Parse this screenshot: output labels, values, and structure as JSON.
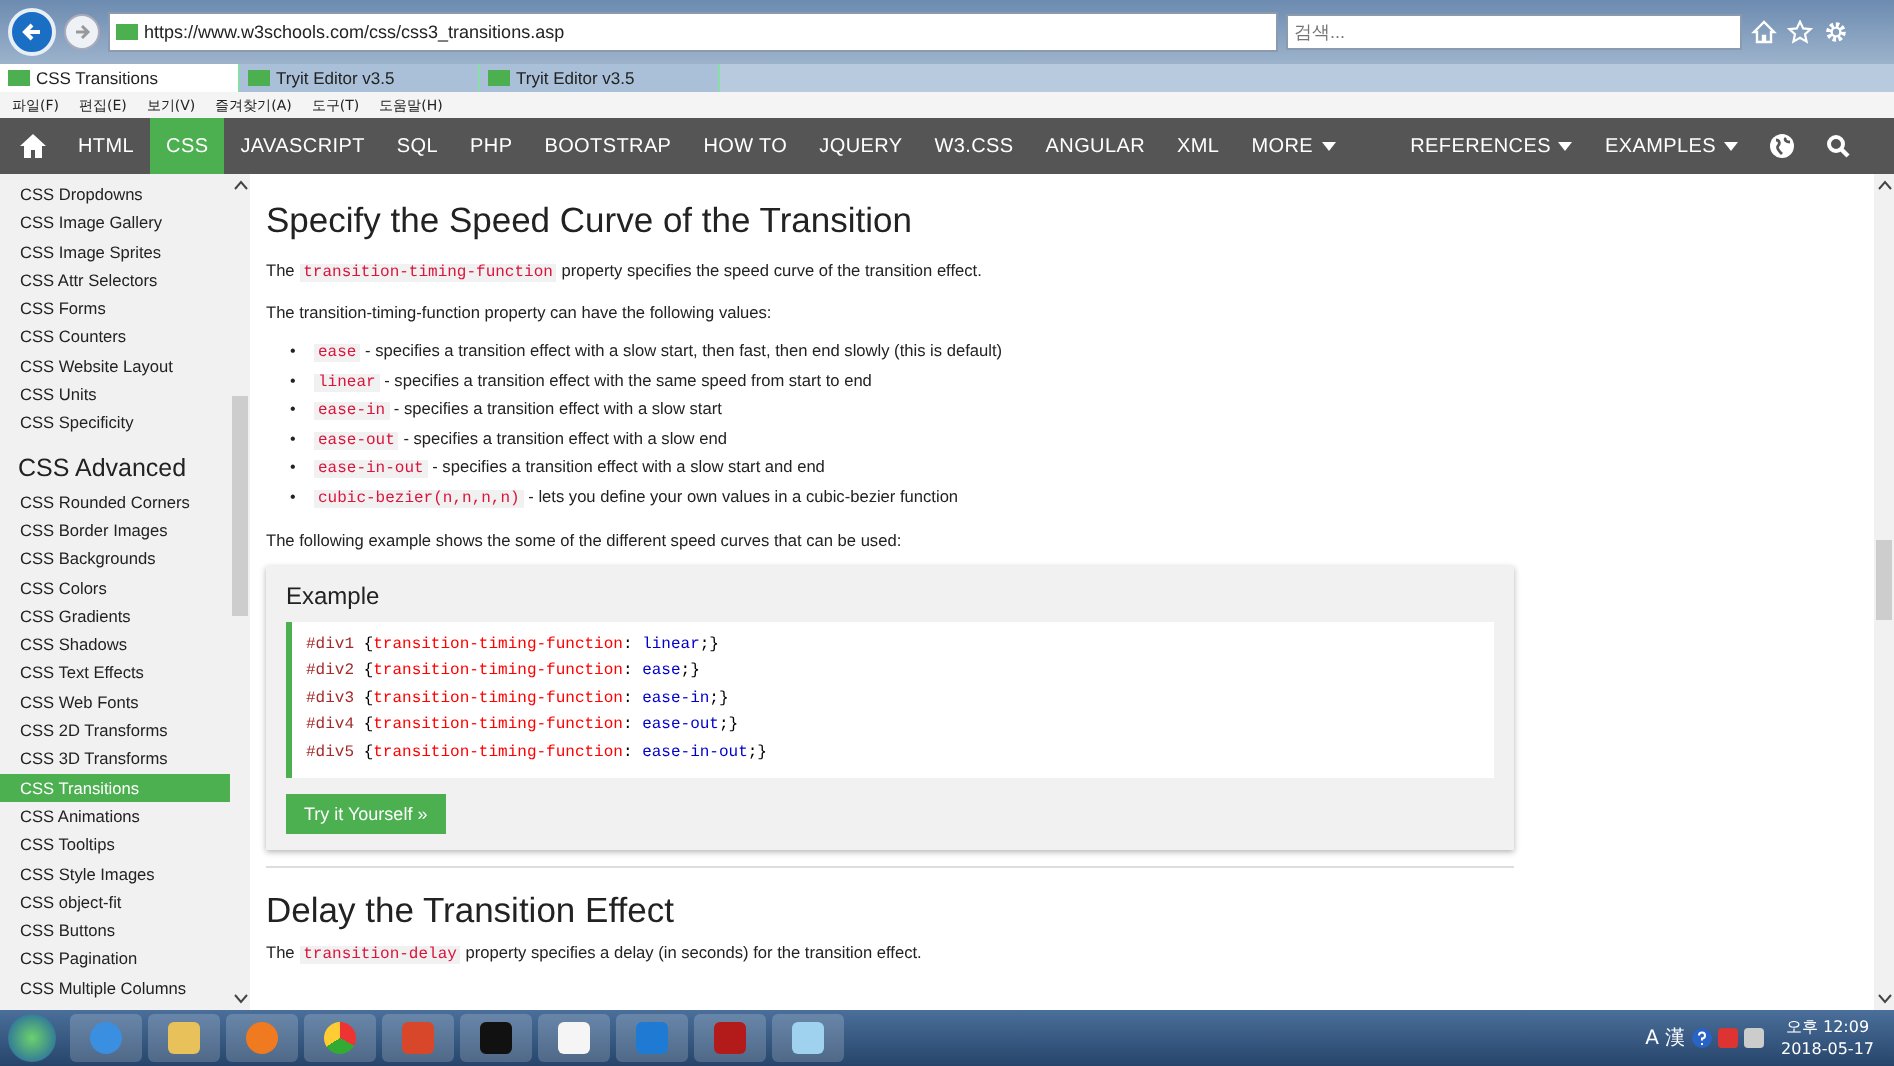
{
  "browser": {
    "url": "https://www.w3schools.com/css/css3_transitions.asp",
    "search_placeholder": "검색...",
    "tabs": [
      {
        "label": "CSS Transitions",
        "selected": true
      },
      {
        "label": "Tryit Editor v3.5",
        "selected": false
      },
      {
        "label": "Tryit Editor v3.5",
        "selected": false
      }
    ],
    "menu": [
      "파일(F)",
      "편집(E)",
      "보기(V)",
      "즐겨찾기(A)",
      "도구(T)",
      "도움말(H)"
    ]
  },
  "nav": {
    "items": [
      {
        "label": "HTML",
        "selected": false,
        "dropdown": false
      },
      {
        "label": "CSS",
        "selected": true,
        "dropdown": false
      },
      {
        "label": "JAVASCRIPT",
        "selected": false,
        "dropdown": false
      },
      {
        "label": "SQL",
        "selected": false,
        "dropdown": false
      },
      {
        "label": "PHP",
        "selected": false,
        "dropdown": false
      },
      {
        "label": "BOOTSTRAP",
        "selected": false,
        "dropdown": false
      },
      {
        "label": "HOW TO",
        "selected": false,
        "dropdown": false
      },
      {
        "label": "JQUERY",
        "selected": false,
        "dropdown": false
      },
      {
        "label": "W3.CSS",
        "selected": false,
        "dropdown": false
      },
      {
        "label": "ANGULAR",
        "selected": false,
        "dropdown": false
      },
      {
        "label": "XML",
        "selected": false,
        "dropdown": false
      },
      {
        "label": "MORE",
        "selected": false,
        "dropdown": true
      }
    ],
    "right_items": [
      {
        "label": "REFERENCES",
        "dropdown": true
      },
      {
        "label": "EXAMPLES",
        "dropdown": true
      }
    ]
  },
  "sidebar": {
    "items_top": [
      {
        "label": "CSS Dropdowns",
        "selected": false
      },
      {
        "label": "CSS Image Gallery",
        "selected": false
      },
      {
        "label": "CSS Image Sprites",
        "selected": false
      },
      {
        "label": "CSS Attr Selectors",
        "selected": false
      },
      {
        "label": "CSS Forms",
        "selected": false
      },
      {
        "label": "CSS Counters",
        "selected": false
      },
      {
        "label": "CSS Website Layout",
        "selected": false
      },
      {
        "label": "CSS Units",
        "selected": false
      },
      {
        "label": "CSS Specificity",
        "selected": false
      }
    ],
    "heading": "CSS Advanced",
    "items": [
      {
        "label": "CSS Rounded Corners",
        "selected": false
      },
      {
        "label": "CSS Border Images",
        "selected": false
      },
      {
        "label": "CSS Backgrounds",
        "selected": false
      },
      {
        "label": "CSS Colors",
        "selected": false
      },
      {
        "label": "CSS Gradients",
        "selected": false
      },
      {
        "label": "CSS Shadows",
        "selected": false
      },
      {
        "label": "CSS Text Effects",
        "selected": false
      },
      {
        "label": "CSS Web Fonts",
        "selected": false
      },
      {
        "label": "CSS 2D Transforms",
        "selected": false
      },
      {
        "label": "CSS 3D Transforms",
        "selected": false
      },
      {
        "label": "CSS Transitions",
        "selected": true
      },
      {
        "label": "CSS Animations",
        "selected": false
      },
      {
        "label": "CSS Tooltips",
        "selected": false
      },
      {
        "label": "CSS Style Images",
        "selected": false
      },
      {
        "label": "CSS object-fit",
        "selected": false
      },
      {
        "label": "CSS Buttons",
        "selected": false
      },
      {
        "label": "CSS Pagination",
        "selected": false
      },
      {
        "label": "CSS Multiple Columns",
        "selected": false
      }
    ]
  },
  "content": {
    "title": "Specify the Speed Curve of the Transition",
    "intro": {
      "before": "The",
      "code": "transition-timing-function",
      "after": "property specifies the speed curve of the transition effect."
    },
    "values_intro": "The transition-timing-function property can have the following values:",
    "values": [
      {
        "marker": "•",
        "code": "ease",
        "text": "- specifies a transition effect with a slow start, then fast, then end slowly (this is default)"
      },
      {
        "marker": "•",
        "code": "linear",
        "text": "- specifies a transition effect with the same speed from start to end"
      },
      {
        "marker": "•",
        "code": "ease-in",
        "text": "- specifies a transition effect with a slow start"
      },
      {
        "marker": "•",
        "code": "ease-out",
        "text": "- specifies a transition effect with a slow end"
      },
      {
        "marker": "•",
        "code": "ease-in-out",
        "text": "- specifies a transition effect with a slow start and end"
      },
      {
        "marker": "•",
        "code": "cubic-bezier(n,n,n,n)",
        "text": "- lets you define your own values in a cubic-bezier function"
      }
    ],
    "example_intro": "The following example shows the some of the different speed curves that can be used:",
    "example": {
      "title": "Example",
      "lines": [
        {
          "selector": "#div1",
          "open": "{",
          "property": "transition-timing-function",
          "colon": ":",
          "value": "linear",
          "close": ";}"
        },
        {
          "selector": "#div2",
          "open": "{",
          "property": "transition-timing-function",
          "colon": ":",
          "value": "ease",
          "close": ";}"
        },
        {
          "selector": "#div3",
          "open": "{",
          "property": "transition-timing-function",
          "colon": ":",
          "value": "ease-in",
          "close": ";}"
        },
        {
          "selector": "#div4",
          "open": "{",
          "property": "transition-timing-function",
          "colon": ":",
          "value": "ease-out",
          "close": ";}"
        },
        {
          "selector": "#div5",
          "open": "{",
          "property": "transition-timing-function",
          "colon": ":",
          "value": "ease-in-out",
          "close": ";}"
        }
      ],
      "button": "Try it Yourself »"
    },
    "section2": {
      "title": "Delay the Transition Effect",
      "before": "The",
      "code": "transition-delay",
      "after": "property specifies a delay (in seconds) for the transition effect."
    }
  },
  "taskbar": {
    "ime": "A",
    "hanja": "漢",
    "time": "오후 12:09",
    "date": "2018-05-17"
  }
}
